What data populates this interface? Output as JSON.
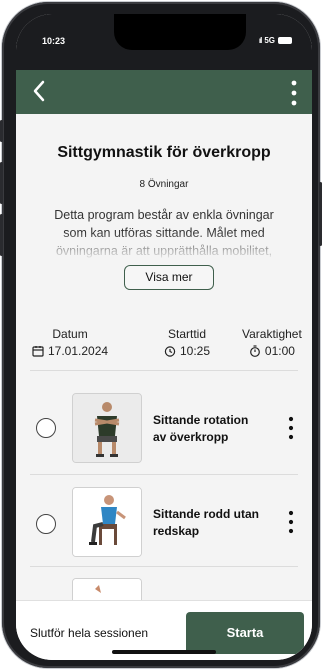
{
  "status": {
    "time": "10:23",
    "network": "5G"
  },
  "header": {
    "back_icon": "back-arrow-icon",
    "menu_icon": "kebab-menu-icon",
    "color": "#3f5f4c"
  },
  "program": {
    "title": "Sittgymnastik för överkropp",
    "count": "8 Övningar",
    "description": "Detta program består av enkla övningar som kan utföras sittande. Målet med övningarna är att upprätthålla mobilitet,",
    "show_more": "Visa mer"
  },
  "info": {
    "date_label": "Datum",
    "date_value": "17.01.2024",
    "start_label": "Starttid",
    "start_value": "10:25",
    "duration_label": "Varaktighet",
    "duration_value": "01:00"
  },
  "exercises": [
    {
      "label": "Sittande rotation av överkropp"
    },
    {
      "label": "Sittande rodd utan redskap"
    }
  ],
  "footer": {
    "finish_label": "Slutför hela sessionen",
    "start_label": "Starta"
  }
}
